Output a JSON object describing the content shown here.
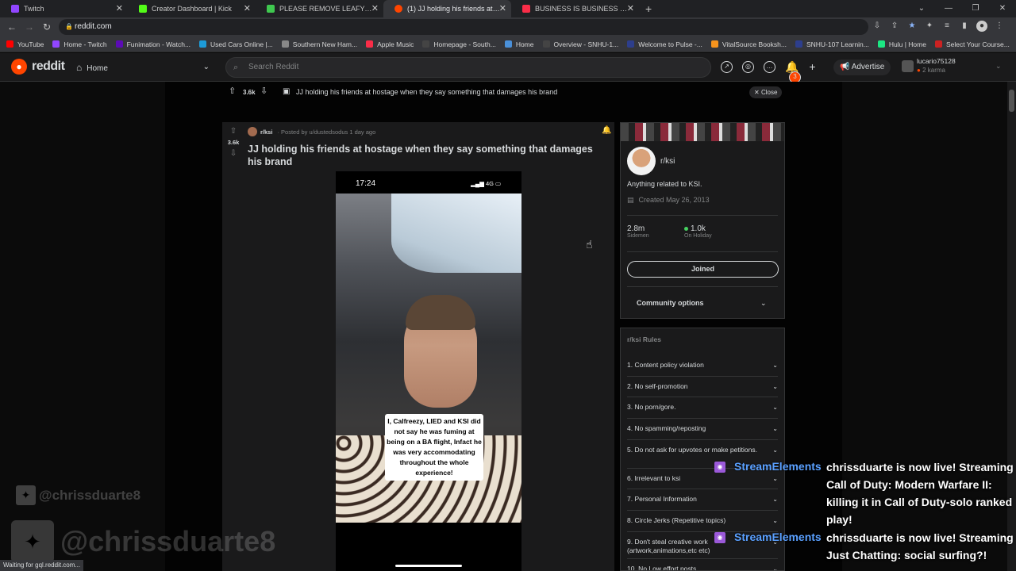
{
  "tabs": [
    {
      "label": "Twitch",
      "color": "#9146ff"
    },
    {
      "label": "Creator Dashboard | Kick",
      "color": "#53fc18"
    },
    {
      "label": "PLEASE REMOVE LEAFY FROM TI",
      "color": "#3fc84f"
    },
    {
      "label": "(1) JJ holding his friends at hosta",
      "color": "#ff4500"
    },
    {
      "label": "BUSINESS IS BUSINESS by Young",
      "color": "#fa2d48"
    }
  ],
  "url": "reddit.com",
  "bookmarks": [
    {
      "label": "YouTube",
      "color": "#ff0000"
    },
    {
      "label": "Home - Twitch",
      "color": "#9146ff"
    },
    {
      "label": "Funimation - Watch...",
      "color": "#5b0bb5"
    },
    {
      "label": "Used Cars Online |...",
      "color": "#1d9bd8"
    },
    {
      "label": "Southern New Ham...",
      "color": "#888888"
    },
    {
      "label": "Apple Music",
      "color": "#fa2d48"
    },
    {
      "label": "Homepage - South...",
      "color": "#444444"
    },
    {
      "label": "Home",
      "color": "#4a90d9"
    },
    {
      "label": "Overview - SNHU-1...",
      "color": "#444444"
    },
    {
      "label": "Welcome to Pulse -...",
      "color": "#2d3e8c"
    },
    {
      "label": "VitalSource Booksh...",
      "color": "#f7941d"
    },
    {
      "label": "SNHU-107 Learnin...",
      "color": "#2d3e8c"
    },
    {
      "label": "Hulu | Home",
      "color": "#1ce783"
    },
    {
      "label": "Select Your Course...",
      "color": "#cc2222"
    }
  ],
  "reddit": {
    "logo_text": "reddit",
    "home_label": "Home",
    "search_placeholder": "Search Reddit",
    "notif_count": "3",
    "advertise_label": "Advertise",
    "username": "lucario75128",
    "karma": "2 karma"
  },
  "post_bar": {
    "votes": "3.6k",
    "title": "JJ holding his friends at hostage when they say something that damages his brand",
    "close_label": "Close"
  },
  "post": {
    "votes": "3.6k",
    "subreddit": "r/ksi",
    "posted_by": "· Posted by u/dustedsodus 1 day ago",
    "title": "JJ holding his friends at hostage when they say something that damages his brand",
    "phone_time": "17:24",
    "phone_signal": "4G",
    "caption": "I, Calfreezy, LIED and KSI did not say he was fuming at being on a BA flight, Infact he was very accommodating throughout the whole experience!"
  },
  "community": {
    "name": "r/ksi",
    "description": "Anything related to KSI.",
    "created": "Created May 26, 2013",
    "members": "2.8m",
    "members_label": "Sidemen",
    "online": "1.0k",
    "online_label": "On Holiday",
    "joined_label": "Joined",
    "options_label": "Community options"
  },
  "rules": {
    "title": "r/ksi Rules",
    "items": [
      "1. Content policy violation",
      "2. No self-promotion",
      "3. No porn/gore.",
      "4. No spamming/reposting",
      "5. Do not ask for upvotes or make petitions.",
      "6. Irrelevant to ksi",
      "7. Personal Information",
      "8. Circle Jerks (Repetitive topics)",
      "9. Don't steal creative work (artwork,animations,etc etc)",
      "10. No Low effort posts"
    ]
  },
  "status_text": "Waiting for gql.reddit.com...",
  "overlay": {
    "twitter_small": "@chrissduarte8",
    "twitter_big": "@chrissduarte8",
    "alerts": [
      {
        "name": "StreamElements",
        "message": "chrissduarte is now live! Streaming Call of Duty: Modern Warfare II: killing it in Call of Duty-solo ranked play!"
      },
      {
        "name": "StreamElements",
        "message": "chrissduarte is now live! Streaming Just Chatting: social surfing?!"
      }
    ]
  }
}
